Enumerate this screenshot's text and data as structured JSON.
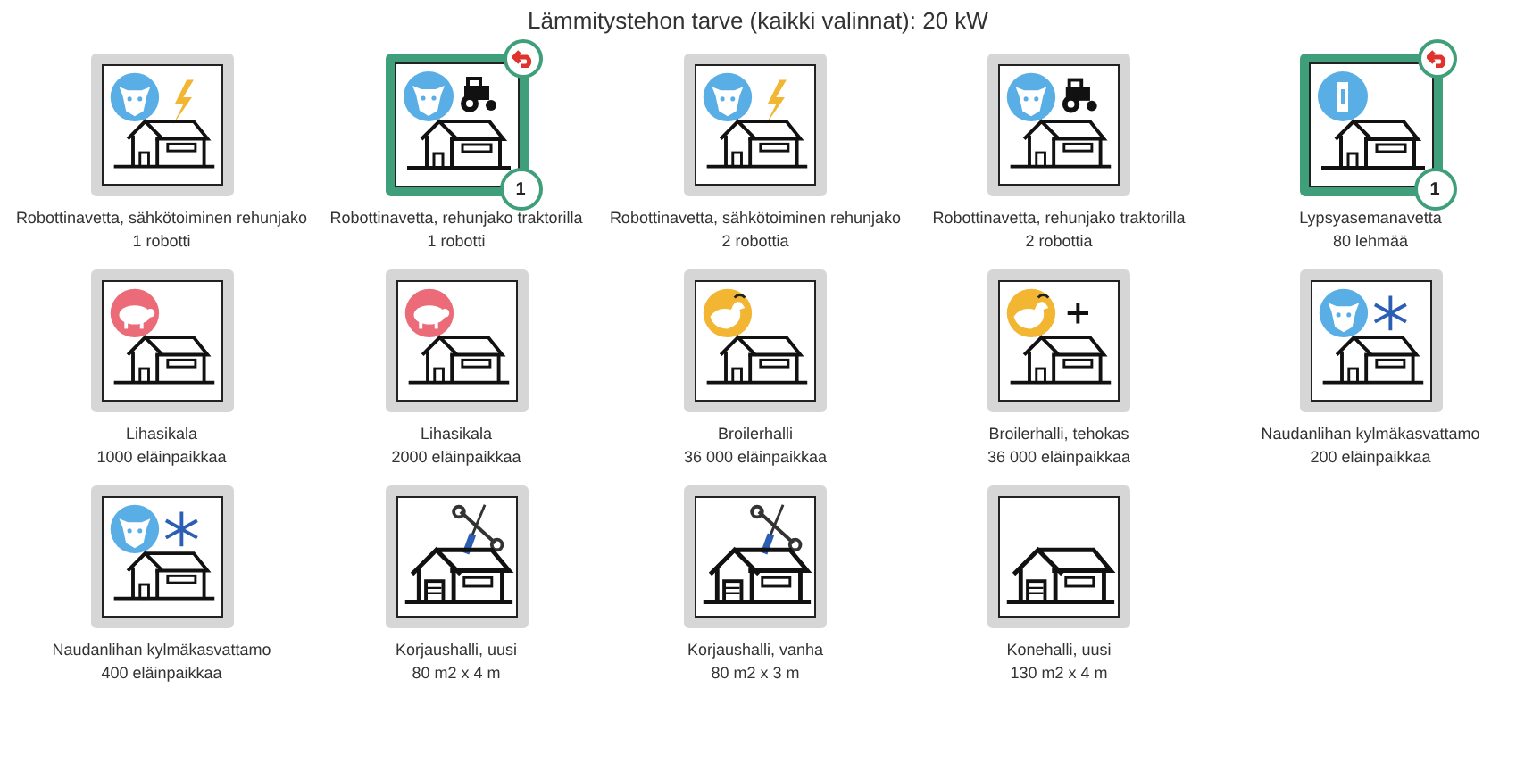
{
  "title": "Lämmitystehon tarve (kaikki valinnat): 20 kW",
  "tiles": [
    {
      "title": "Robottinavetta, sähkötoiminen rehunjako",
      "subtitle": "1 robotti",
      "selected": false,
      "icons": [
        {
          "kind": "cow"
        },
        {
          "kind": "bolt"
        },
        {
          "kind": "barn"
        }
      ]
    },
    {
      "title": "Robottinavetta, rehunjako traktorilla",
      "subtitle": "1 robotti",
      "selected": true,
      "count": "1",
      "icons": [
        {
          "kind": "cow"
        },
        {
          "kind": "tractor"
        },
        {
          "kind": "barn"
        }
      ]
    },
    {
      "title": "Robottinavetta, sähkötoiminen rehunjako",
      "subtitle": "2 robottia",
      "selected": false,
      "icons": [
        {
          "kind": "cow"
        },
        {
          "kind": "bolt"
        },
        {
          "kind": "barn"
        }
      ]
    },
    {
      "title": "Robottinavetta, rehunjako traktorilla",
      "subtitle": "2 robottia",
      "selected": false,
      "icons": [
        {
          "kind": "cow"
        },
        {
          "kind": "tractor"
        },
        {
          "kind": "barn"
        }
      ]
    },
    {
      "title": "Lypsyasemanavetta",
      "subtitle": "80 lehmää",
      "selected": true,
      "count": "1",
      "icons": [
        {
          "kind": "milk"
        },
        {
          "kind": "barn"
        }
      ]
    },
    {
      "title": "Lihasikala",
      "subtitle": "1000 eläinpaikkaa",
      "selected": false,
      "icons": [
        {
          "kind": "pig"
        },
        {
          "kind": "barn"
        }
      ]
    },
    {
      "title": "Lihasikala",
      "subtitle": "2000 eläinpaikkaa",
      "selected": false,
      "icons": [
        {
          "kind": "pig"
        },
        {
          "kind": "barn"
        }
      ]
    },
    {
      "title": "Broilerhalli",
      "subtitle": "36 000 eläinpaikkaa",
      "selected": false,
      "icons": [
        {
          "kind": "chicken"
        },
        {
          "kind": "barn"
        }
      ]
    },
    {
      "title": "Broilerhalli, tehokas",
      "subtitle": "36 000 eläinpaikkaa",
      "selected": false,
      "icons": [
        {
          "kind": "chicken"
        },
        {
          "kind": "plus"
        },
        {
          "kind": "barn"
        }
      ]
    },
    {
      "title": "Naudanlihan kylmäkasvattamo",
      "subtitle": "200 eläinpaikkaa",
      "selected": false,
      "icons": [
        {
          "kind": "cow"
        },
        {
          "kind": "snowflake"
        },
        {
          "kind": "barn"
        }
      ]
    },
    {
      "title": "Naudanlihan kylmäkasvattamo",
      "subtitle": "400 eläinpaikkaa",
      "selected": false,
      "icons": [
        {
          "kind": "cow"
        },
        {
          "kind": "snowflake"
        },
        {
          "kind": "barn"
        }
      ]
    },
    {
      "title": "Korjaushalli, uusi",
      "subtitle": "80 m2 x 4 m",
      "selected": false,
      "icons": [
        {
          "kind": "tools"
        },
        {
          "kind": "garage"
        }
      ]
    },
    {
      "title": "Korjaushalli, vanha",
      "subtitle": "80 m2 x 3 m",
      "selected": false,
      "icons": [
        {
          "kind": "tools"
        },
        {
          "kind": "garage"
        }
      ]
    },
    {
      "title": "Konehalli, uusi",
      "subtitle": "130 m2 x 4 m",
      "selected": false,
      "icons": [
        {
          "kind": "garage"
        }
      ]
    }
  ]
}
